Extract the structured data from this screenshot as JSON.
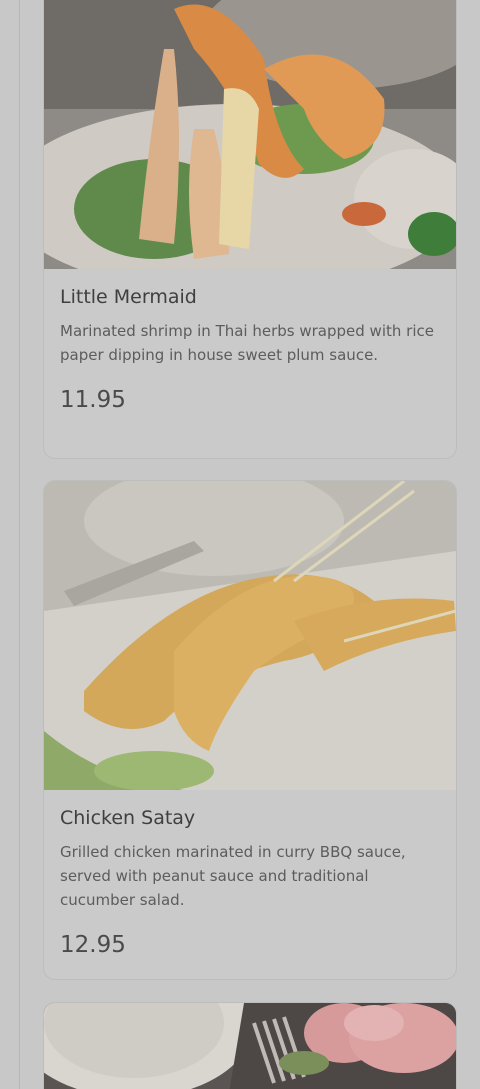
{
  "menu": {
    "items": [
      {
        "name": "Little Mermaid",
        "fav_glyph": "",
        "description": "Marinated shrimp in Thai herbs wrapped with rice paper dipping in house sweet plum sauce.",
        "price": "11.95",
        "image_icon": "shrimp-dish-photo"
      },
      {
        "name": "Chicken Satay",
        "fav_glyph": "",
        "description": "Grilled chicken marinated in curry BBQ sauce, served with peanut sauce and traditional cucumber salad.",
        "price": "12.95",
        "image_icon": "satay-dish-photo"
      },
      {
        "image_icon": "table-setting-photo"
      }
    ]
  },
  "colors": {
    "overlay": "#c8c8c8",
    "card_border": "#bdbdbd",
    "title_text": "#3f3f3f",
    "body_text": "#5c5c5c"
  }
}
